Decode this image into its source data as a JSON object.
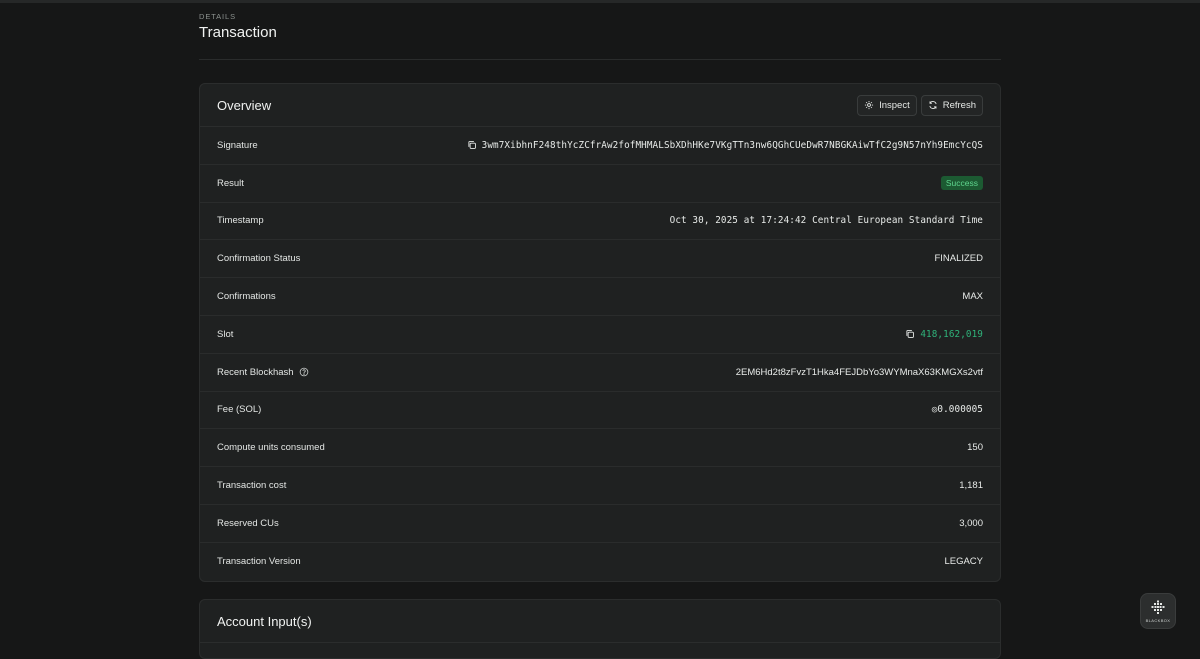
{
  "header": {
    "eyebrow": "DETAILS",
    "title": "Transaction"
  },
  "overview": {
    "title": "Overview",
    "inspect_label": "Inspect",
    "refresh_label": "Refresh",
    "rows": [
      {
        "label": "Signature",
        "value": "3wm7XibhnF248thYcZCfrAw2fofMHMALSbXDhHKe7VKgTTn3nw6QGhCUeDwR7NBGKAiwTfC2g9N57nYh9EmcYcQS"
      },
      {
        "label": "Result",
        "value": "Success"
      },
      {
        "label": "Timestamp",
        "value": "Oct 30, 2025 at 17:24:42 Central European Standard Time"
      },
      {
        "label": "Confirmation Status",
        "value": "FINALIZED"
      },
      {
        "label": "Confirmations",
        "value": "MAX"
      },
      {
        "label": "Slot",
        "value": "418,162,019"
      },
      {
        "label": "Recent Blockhash",
        "value": "2EM6Hd2t8zFvzT1Hka4FEJDbYo3WYMnaX63KMGXs2vtf"
      },
      {
        "label": "Fee (SOL)",
        "value": "◎0.000005"
      },
      {
        "label": "Compute units consumed",
        "value": "150"
      },
      {
        "label": "Transaction cost",
        "value": "1,181"
      },
      {
        "label": "Reserved CUs",
        "value": "3,000"
      },
      {
        "label": "Transaction Version",
        "value": "LEGACY"
      }
    ]
  },
  "accounts": {
    "title": "Account Input(s)"
  },
  "widget": {
    "label": "BLACKBOX"
  },
  "colors": {
    "background": "#161717",
    "card": "#1f2121",
    "success_badge": "#1c5a32",
    "slot_link": "#2fb37a"
  }
}
